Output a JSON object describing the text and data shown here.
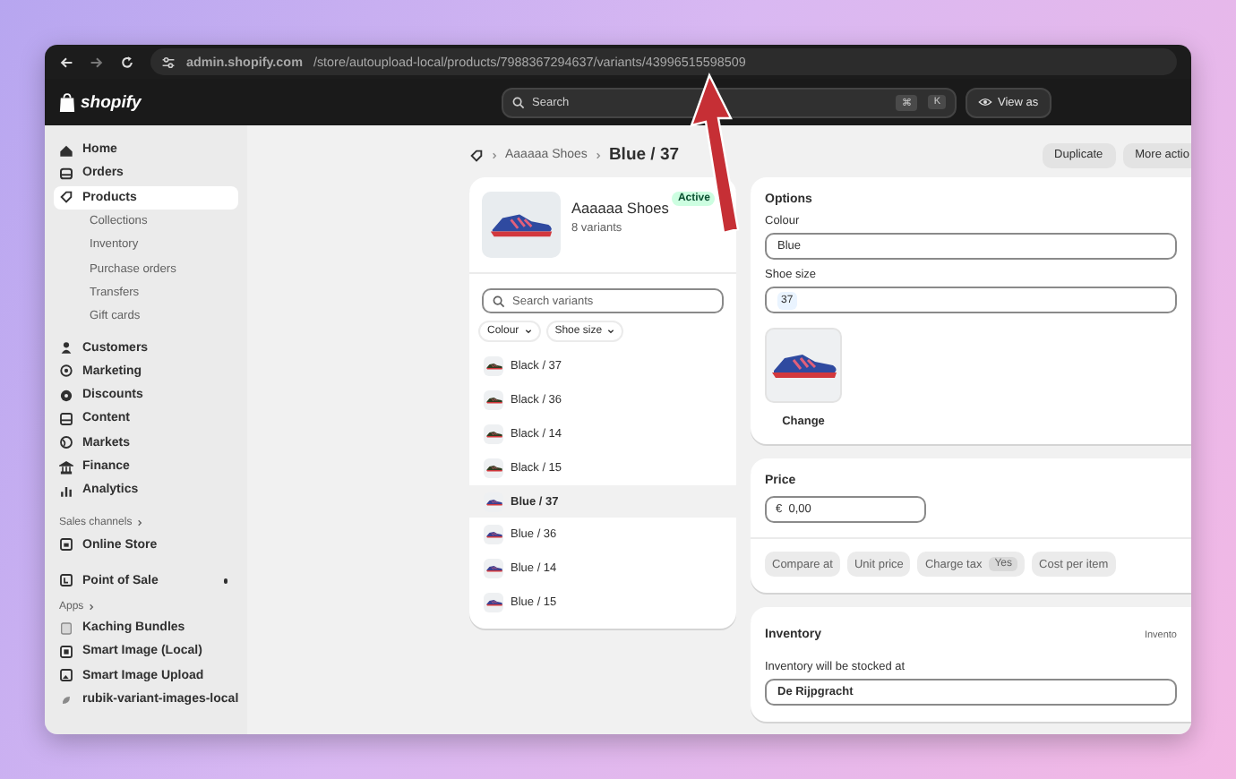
{
  "browser": {
    "url": "**admin.shopify.com**/store/autoupload-local/products/7988367294637/variants/43996515598509"
  },
  "header": {
    "logo": "shopify",
    "search_placeholder": "Search",
    "shortcut": [
      "⌘",
      "K"
    ],
    "view_as": "View as"
  },
  "sidebar": {
    "items": [
      {
        "label": "Home",
        "selected": false
      },
      {
        "label": "Orders",
        "selected": false
      },
      {
        "label": "Products",
        "selected": true,
        "children": [
          {
            "label": "Collections",
            "selected": false
          },
          {
            "label": "Inventory",
            "selected": false
          },
          {
            "label": "Purchase orders",
            "selected": false
          },
          {
            "label": "Transfers",
            "selected": false
          },
          {
            "label": "Gift cards",
            "selected": false
          }
        ]
      },
      {
        "label": "Customers",
        "selected": false
      },
      {
        "label": "Marketing",
        "selected": false
      },
      {
        "label": "Discounts",
        "selected": false
      },
      {
        "label": "Content",
        "selected": false
      },
      {
        "label": "Markets",
        "selected": false
      },
      {
        "label": "Finance",
        "selected": false
      },
      {
        "label": "Analytics",
        "selected": false
      }
    ],
    "sections": [
      {
        "title": "Sales channels",
        "items": [
          {
            "label": "Online Store",
            "selected": false,
            "pinned": false
          },
          {
            "label": "Point of Sale",
            "selected": false,
            "pinned": true
          }
        ]
      },
      {
        "title": "Apps",
        "items": [
          {
            "label": "Kaching Bundles",
            "selected": false
          },
          {
            "label": "Smart Image (Local)",
            "selected": false
          },
          {
            "label": "Smart Image Upload",
            "selected": false
          },
          {
            "label": "rubik-variant-images-local",
            "selected": false
          }
        ]
      }
    ]
  },
  "breadcrumb": {
    "parent": "Aaaaaa Shoes",
    "current": "Blue / 37"
  },
  "actions": [
    "Duplicate",
    "More actio"
  ],
  "product": {
    "name": "Aaaaaa Shoes",
    "status": "Active",
    "variant_count": "8 variants",
    "search_placeholder": "Search variants",
    "filters": [
      "Colour",
      "Shoe size"
    ],
    "variants": [
      {
        "label": "Black / 37",
        "selected": false,
        "color": "#2f3b1f"
      },
      {
        "label": "Black / 36",
        "selected": false,
        "color": "#2f3b1f"
      },
      {
        "label": "Black / 14",
        "selected": false,
        "color": "#2f3b1f"
      },
      {
        "label": "Black / 15",
        "selected": false,
        "color": "#2f3b1f"
      },
      {
        "label": "Blue / 37",
        "selected": true,
        "color": "#3b3f8f"
      },
      {
        "label": "Blue / 36",
        "selected": false,
        "color": "#3b3f8f"
      },
      {
        "label": "Blue / 14",
        "selected": false,
        "color": "#3b3f8f"
      },
      {
        "label": "Blue / 15",
        "selected": false,
        "color": "#3b3f8f"
      }
    ]
  },
  "options": {
    "title": "Options",
    "fields": [
      {
        "label": "Colour",
        "value": "Blue",
        "kind": "select"
      },
      {
        "label": "Shoe size",
        "value": "37",
        "kind": "tags"
      }
    ],
    "image_action": "Change"
  },
  "price": {
    "title": "Price",
    "currency": "€",
    "value": "0,00",
    "chips": [
      {
        "label": "Compare at"
      },
      {
        "label": "Unit price"
      },
      {
        "label": "Charge tax",
        "badge": "Yes"
      },
      {
        "label": "Cost per item"
      }
    ]
  },
  "inventory": {
    "title": "Inventory",
    "link": "Invento",
    "location_label": "Inventory will be stocked at",
    "location": "De Rijpgracht"
  }
}
